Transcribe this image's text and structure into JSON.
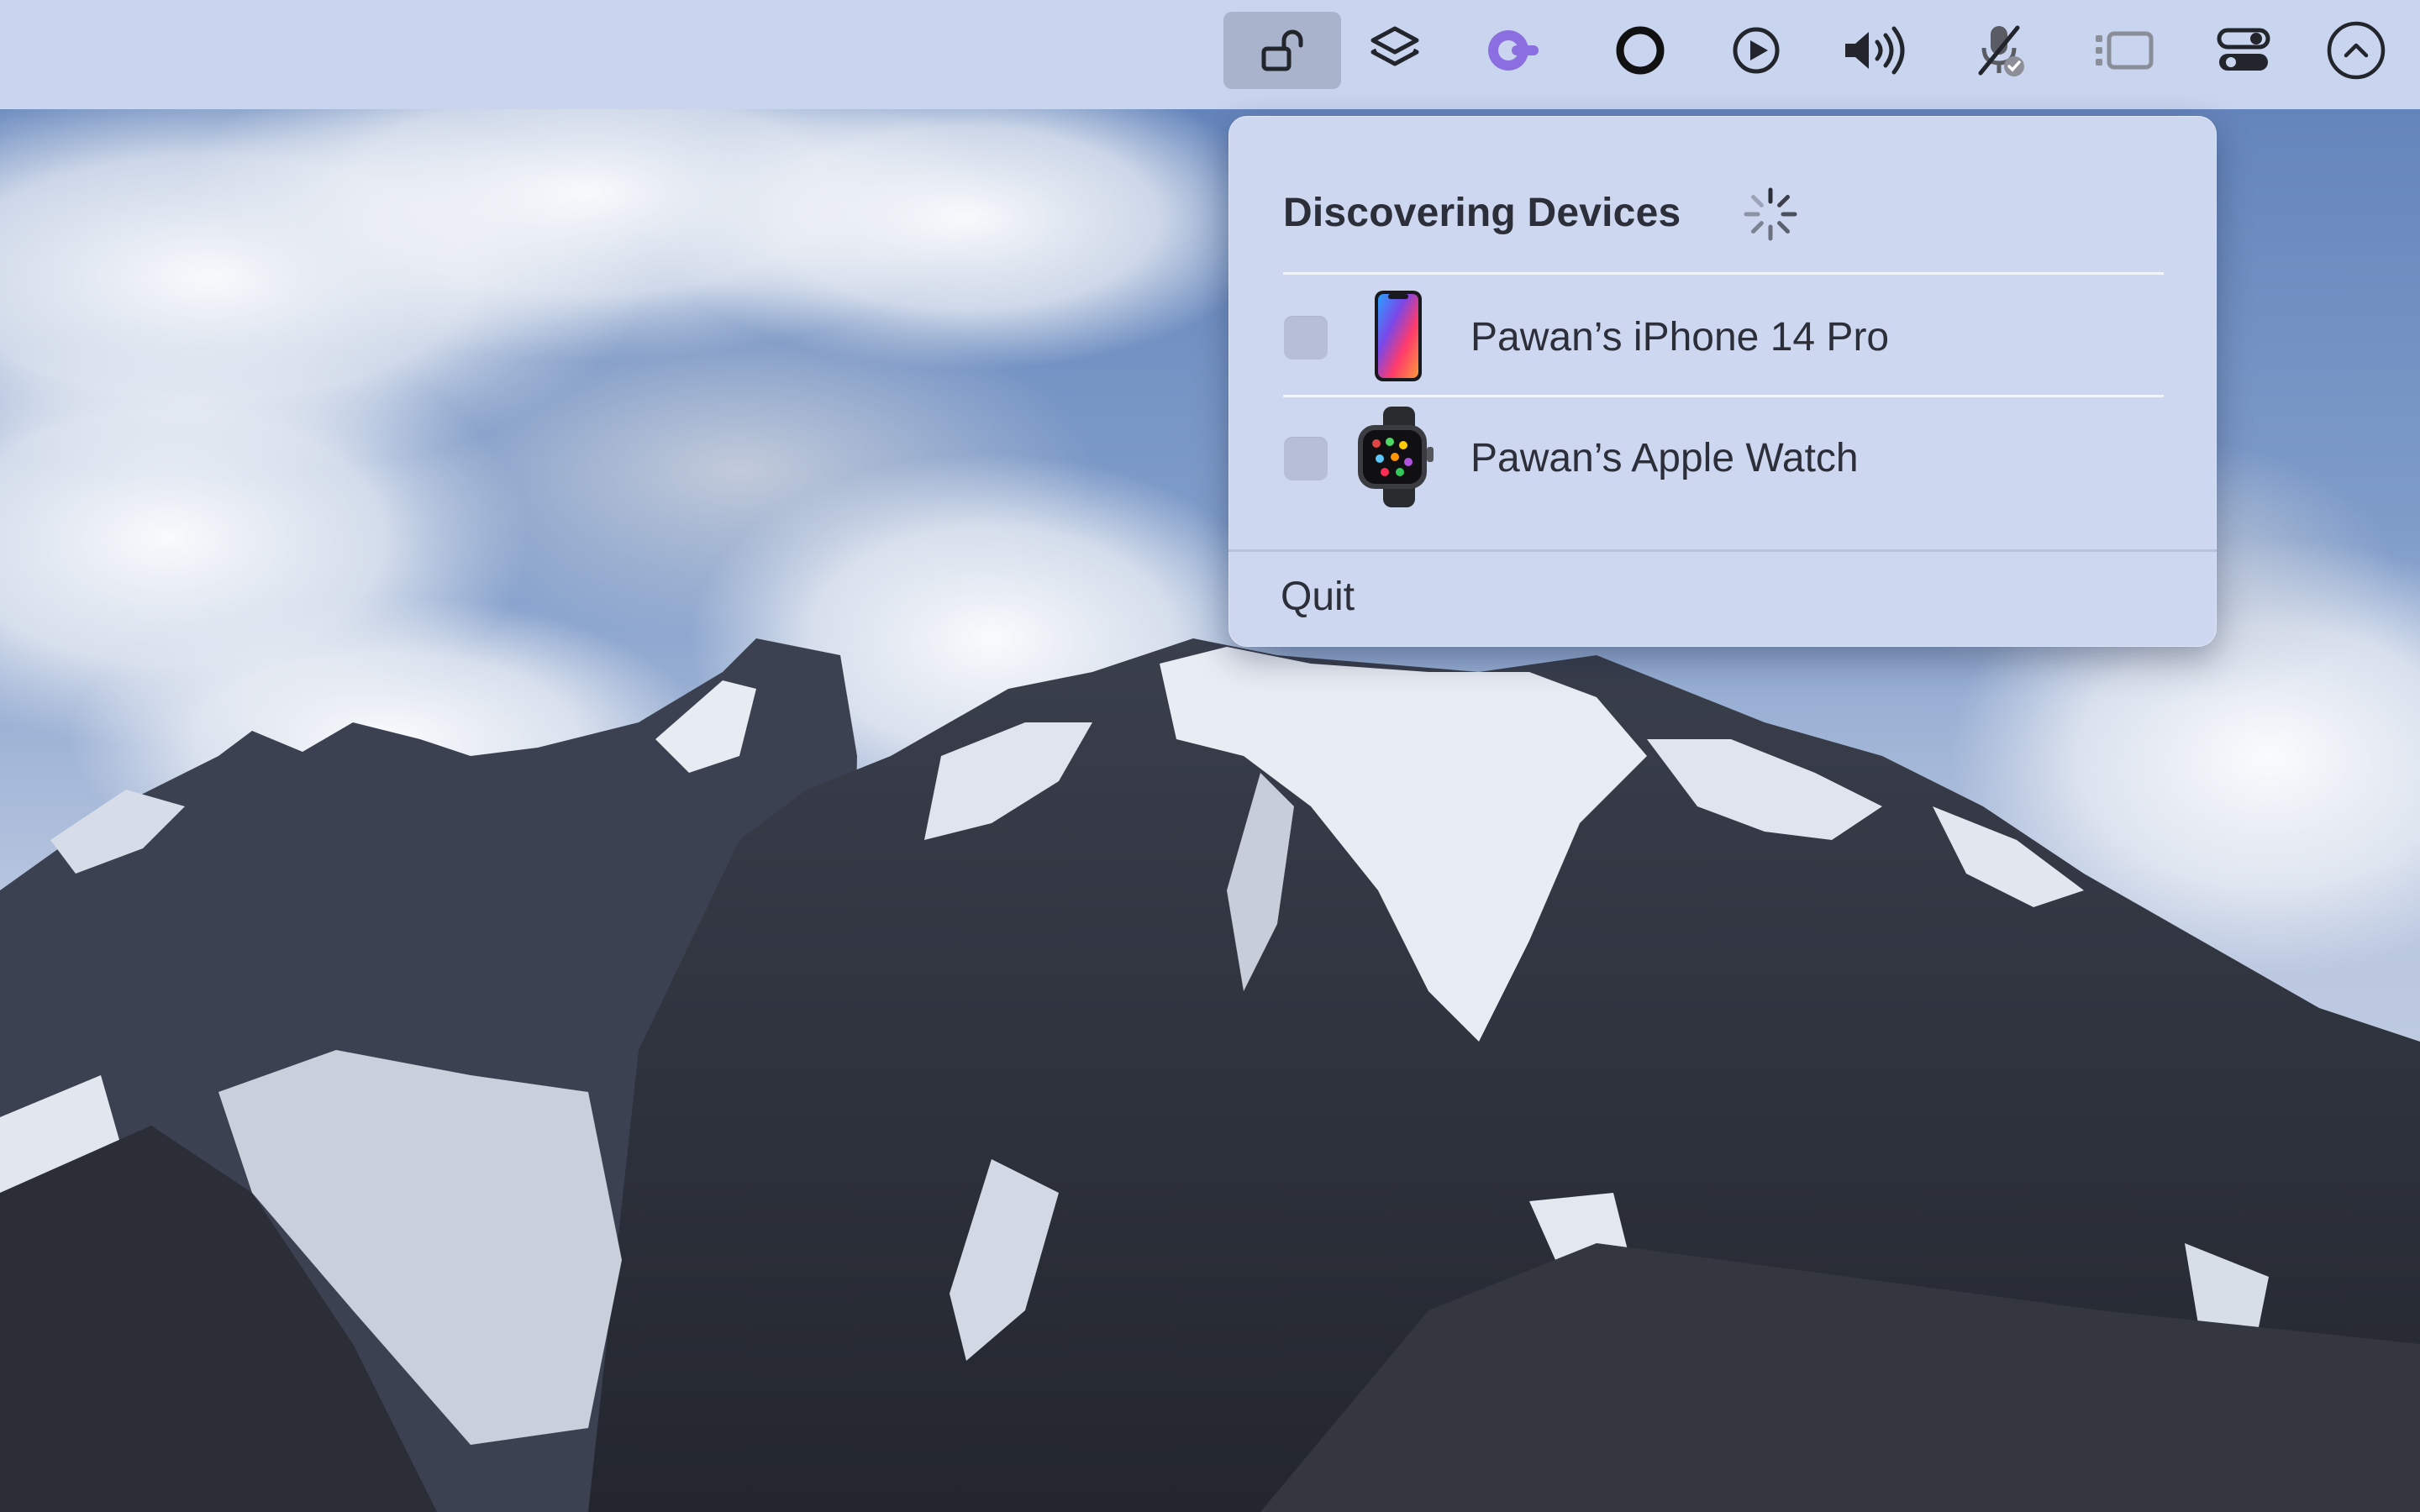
{
  "menubar": {
    "items": [
      {
        "icon": "unlock-icon",
        "active": true
      },
      {
        "icon": "stack-layers-icon"
      },
      {
        "icon": "purple-app-icon",
        "color": "#8b6fe0"
      },
      {
        "icon": "record-circle-icon"
      },
      {
        "icon": "play-circle-icon"
      },
      {
        "icon": "volume-icon"
      },
      {
        "icon": "microphone-muted-icon"
      },
      {
        "icon": "sidebar-icon"
      },
      {
        "icon": "control-center-icon"
      },
      {
        "icon": "chevron-up-circle-icon"
      }
    ]
  },
  "panel": {
    "title": "Discovering Devices",
    "devices": [
      {
        "name": "Pawan’s iPhone 14 Pro",
        "icon": "iphone-icon",
        "checked": false
      },
      {
        "name": "Pawan’s Apple Watch",
        "icon": "apple-watch-icon",
        "checked": false
      }
    ],
    "quit_label": "Quit"
  },
  "colors": {
    "menubar_bg": "#c9d4ef",
    "panel_bg": "#cdd7ef",
    "text": "#2c2f3a",
    "accent_purple": "#8b6fe0"
  }
}
